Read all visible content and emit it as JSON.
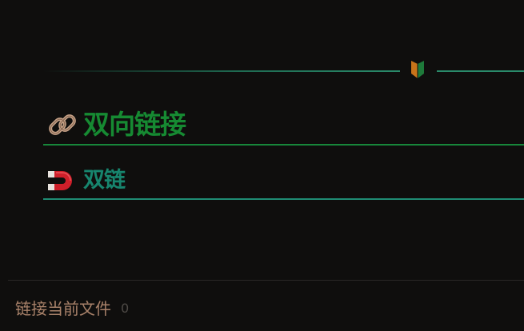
{
  "divider": {
    "line_color": "#2a8a6a",
    "mark_icon": "beginner-mark-icon"
  },
  "headings": {
    "h2": {
      "text": "双向链接",
      "icon": "link-icon",
      "color": "#168a32",
      "underline_color": "#17863a"
    },
    "h3": {
      "text": "双链",
      "icon": "magnet-icon",
      "color": "#17856e",
      "underline_color": "#1f8c74"
    }
  },
  "footer": {
    "label": "链接当前文件",
    "count": "0",
    "label_color": "#a9826a"
  },
  "colors": {
    "background": "#0f0e0d"
  }
}
